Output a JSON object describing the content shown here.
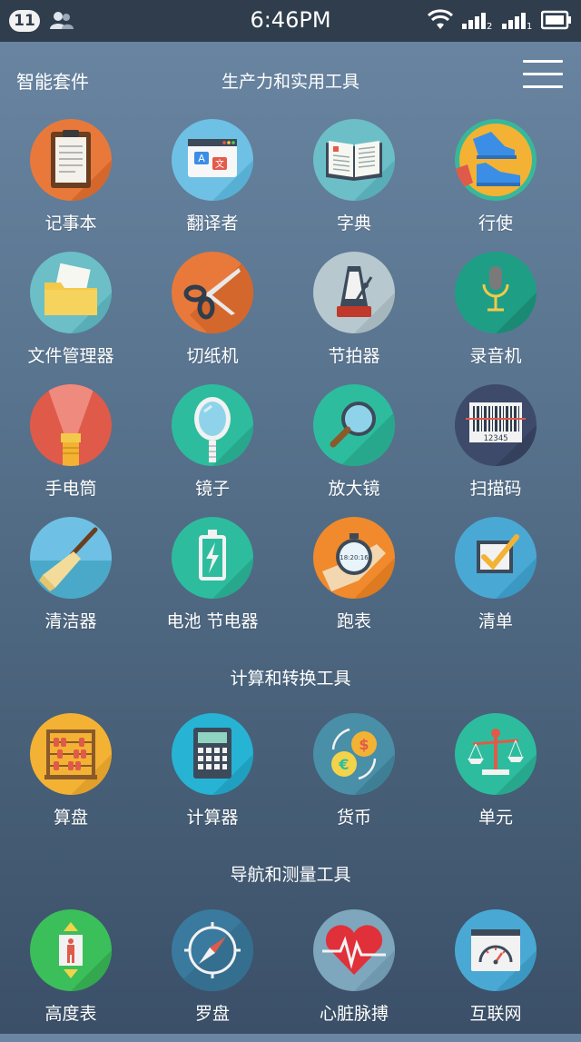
{
  "status": {
    "notification_count": "11",
    "time": "6:46PM",
    "sim1_label": "1",
    "sim2_label": "2"
  },
  "header": {
    "app_title": "智能套件",
    "section_title": "生产力和实用工具"
  },
  "sections": [
    {
      "title": "生产力和实用工具",
      "items": [
        {
          "label": "记事本",
          "icon": "notepad-icon"
        },
        {
          "label": "翻译者",
          "icon": "translator-icon"
        },
        {
          "label": "字典",
          "icon": "dictionary-icon"
        },
        {
          "label": "行使",
          "icon": "shoes-icon"
        },
        {
          "label": "文件管理器",
          "icon": "folder-icon"
        },
        {
          "label": "切纸机",
          "icon": "scissors-icon"
        },
        {
          "label": "节拍器",
          "icon": "metronome-icon"
        },
        {
          "label": "录音机",
          "icon": "microphone-icon"
        },
        {
          "label": "手电筒",
          "icon": "flashlight-icon"
        },
        {
          "label": "镜子",
          "icon": "mirror-icon"
        },
        {
          "label": "放大镜",
          "icon": "magnifier-icon"
        },
        {
          "label": "扫描码",
          "icon": "barcode-icon"
        },
        {
          "label": "清洁器",
          "icon": "broom-icon"
        },
        {
          "label": "电池 节电器",
          "icon": "battery-icon"
        },
        {
          "label": "跑表",
          "icon": "stopwatch-icon"
        },
        {
          "label": "清单",
          "icon": "checklist-icon"
        }
      ]
    },
    {
      "title": "计算和转换工具",
      "items": [
        {
          "label": "算盘",
          "icon": "abacus-icon"
        },
        {
          "label": "计算器",
          "icon": "calculator-icon"
        },
        {
          "label": "货币",
          "icon": "currency-icon"
        },
        {
          "label": "单元",
          "icon": "scale-icon"
        }
      ]
    },
    {
      "title": "导航和测量工具",
      "items": [
        {
          "label": "高度表",
          "icon": "elevator-icon"
        },
        {
          "label": "罗盘",
          "icon": "compass-icon"
        },
        {
          "label": "心脏脉搏",
          "icon": "heart-pulse-icon"
        },
        {
          "label": "互联网",
          "icon": "speedometer-icon"
        }
      ]
    }
  ],
  "icon_texts": {
    "translator_a": "A",
    "translator_b": "文",
    "barcode_digits": "12345",
    "stopwatch_time": "18:20:16",
    "currency_dollar": "$",
    "currency_euro": "€"
  },
  "colors": {
    "status_bar": "#2f3d4d",
    "orange": "#e8793a",
    "teal": "#2dbd9e",
    "blue": "#4aa9d4",
    "red": "#e05a4a",
    "yellow": "#f3b234"
  }
}
